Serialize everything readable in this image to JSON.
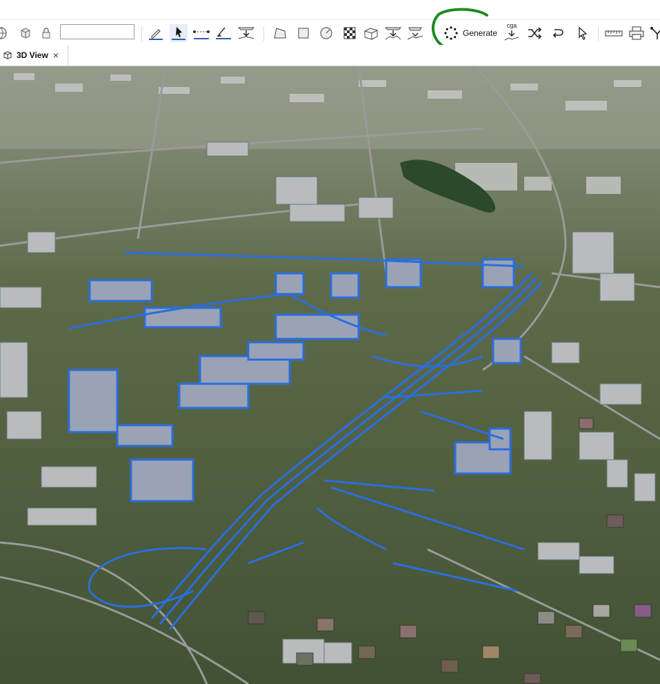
{
  "toolbar": {
    "name_field_value": "",
    "generate_label": "Generate",
    "cga_label": "cga",
    "icons": [
      "globe-icon",
      "cube-icon",
      "lock-icon",
      "edit-icon",
      "select-icon",
      "measure-line-icon",
      "paint-tool-icon",
      "snap-down-icon",
      "polygon-icon",
      "rectangle-icon",
      "circle-icon",
      "texture-icon",
      "extrude-box-icon",
      "align-down-icon",
      "align-terrain-icon",
      "generate-icon",
      "cga-icon",
      "random-seed-icon",
      "undo-icon",
      "cursor-icon",
      "ruler-icon",
      "printer-icon",
      "split-icon"
    ]
  },
  "tabs": [
    {
      "label": "3D View",
      "active": true
    }
  ],
  "viewport": {
    "content": "3D city scene",
    "selection_color": "#2a6ee0",
    "annotation_color": "#1f8a1f"
  }
}
